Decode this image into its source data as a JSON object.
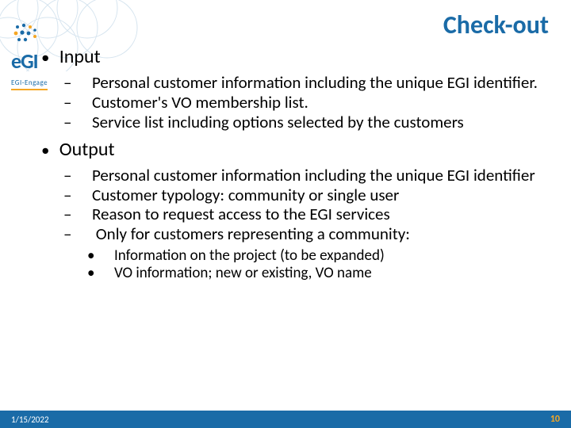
{
  "logo": {
    "brand": "eGI",
    "subline": "EGI-Engage"
  },
  "title": "Check-out",
  "sections": [
    {
      "label": "Input",
      "items": [
        "Personal customer information including the unique EGI identifier.",
        "Customer's VO membership list.",
        "Service list including options selected by the customers"
      ]
    },
    {
      "label": "Output",
      "items": [
        "Personal customer information including the unique EGI identifier",
        "Customer typology: community or single user",
        "Reason to request access to the EGI services",
        "Only for customers representing a community:"
      ],
      "subitems_for_last": [
        "Information on the project (to be expanded)",
        "VO information; new or existing, VO name"
      ]
    }
  ],
  "footer": {
    "date": "1/15/2022",
    "page": "10"
  }
}
